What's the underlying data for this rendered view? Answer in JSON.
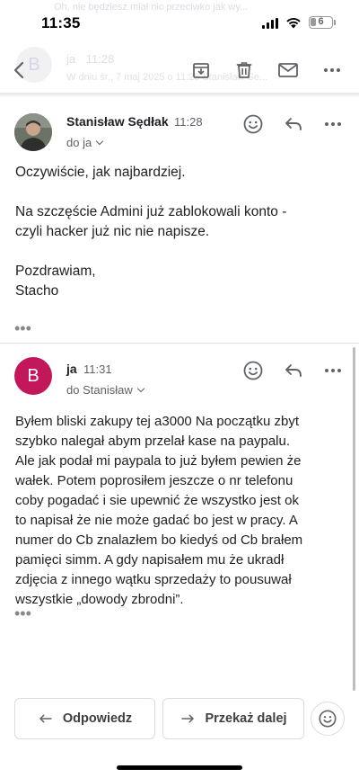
{
  "status_bar": {
    "time": "11:35",
    "battery": "6"
  },
  "background_remnants": {
    "line": "Oh, nie będziesz miał nic przeciwko jak wy...",
    "avatar_letter": "B",
    "sender": "ja",
    "time": "11:28",
    "sub": "W dniu śr., 7 maj 2025 o 11:28 Stanisław Se..."
  },
  "toolbar": {
    "back": "back-arrow-icon",
    "archive": "archive-icon",
    "delete": "trash-icon",
    "mark_unread": "mail-icon",
    "more": "more-horizontal-icon"
  },
  "messages": [
    {
      "sender": "Stanisław Sędłak",
      "time": "11:28",
      "recipient": "do ja",
      "body": [
        "Oczywiście, jak najbardziej.",
        "",
        "Na szczęście Admini już zablokowali konto -",
        "czyli hacker już nic nie napisze.",
        "",
        "Pozdrawiam,",
        "Stacho"
      ],
      "quoted": "•••"
    },
    {
      "avatar_letter": "B",
      "sender": "ja",
      "time": "11:31",
      "recipient": "do Stanisław",
      "body": [
        "Byłem bliski zakupy tej a3000 Na początku zbyt",
        "szybko nalegał abym przelał kase na paypalu.",
        "Ale jak podał mi paypala to już byłem pewien że",
        "wałek. Potem poprosiłem jeszcze o nr telefonu",
        "coby pogadać i sie upewnić że wszystko jest ok",
        "to napisał że nie może gadać bo jest w pracy. A",
        "numer do Cb znalazłem bo kiedyś od Cb brałem",
        "pamięci simm. A gdy napisałem mu że ukradł",
        "zdjęcia z innego wątku sprzedaży to pousuwał",
        "wszystkie „dowody zbrodni”."
      ],
      "quoted": "•••"
    }
  ],
  "actions": {
    "reply": "Odpowiedz",
    "forward": "Przekaż dalej"
  },
  "colors": {
    "avatar_b": "#c2185b",
    "icon": "#5f6368"
  }
}
